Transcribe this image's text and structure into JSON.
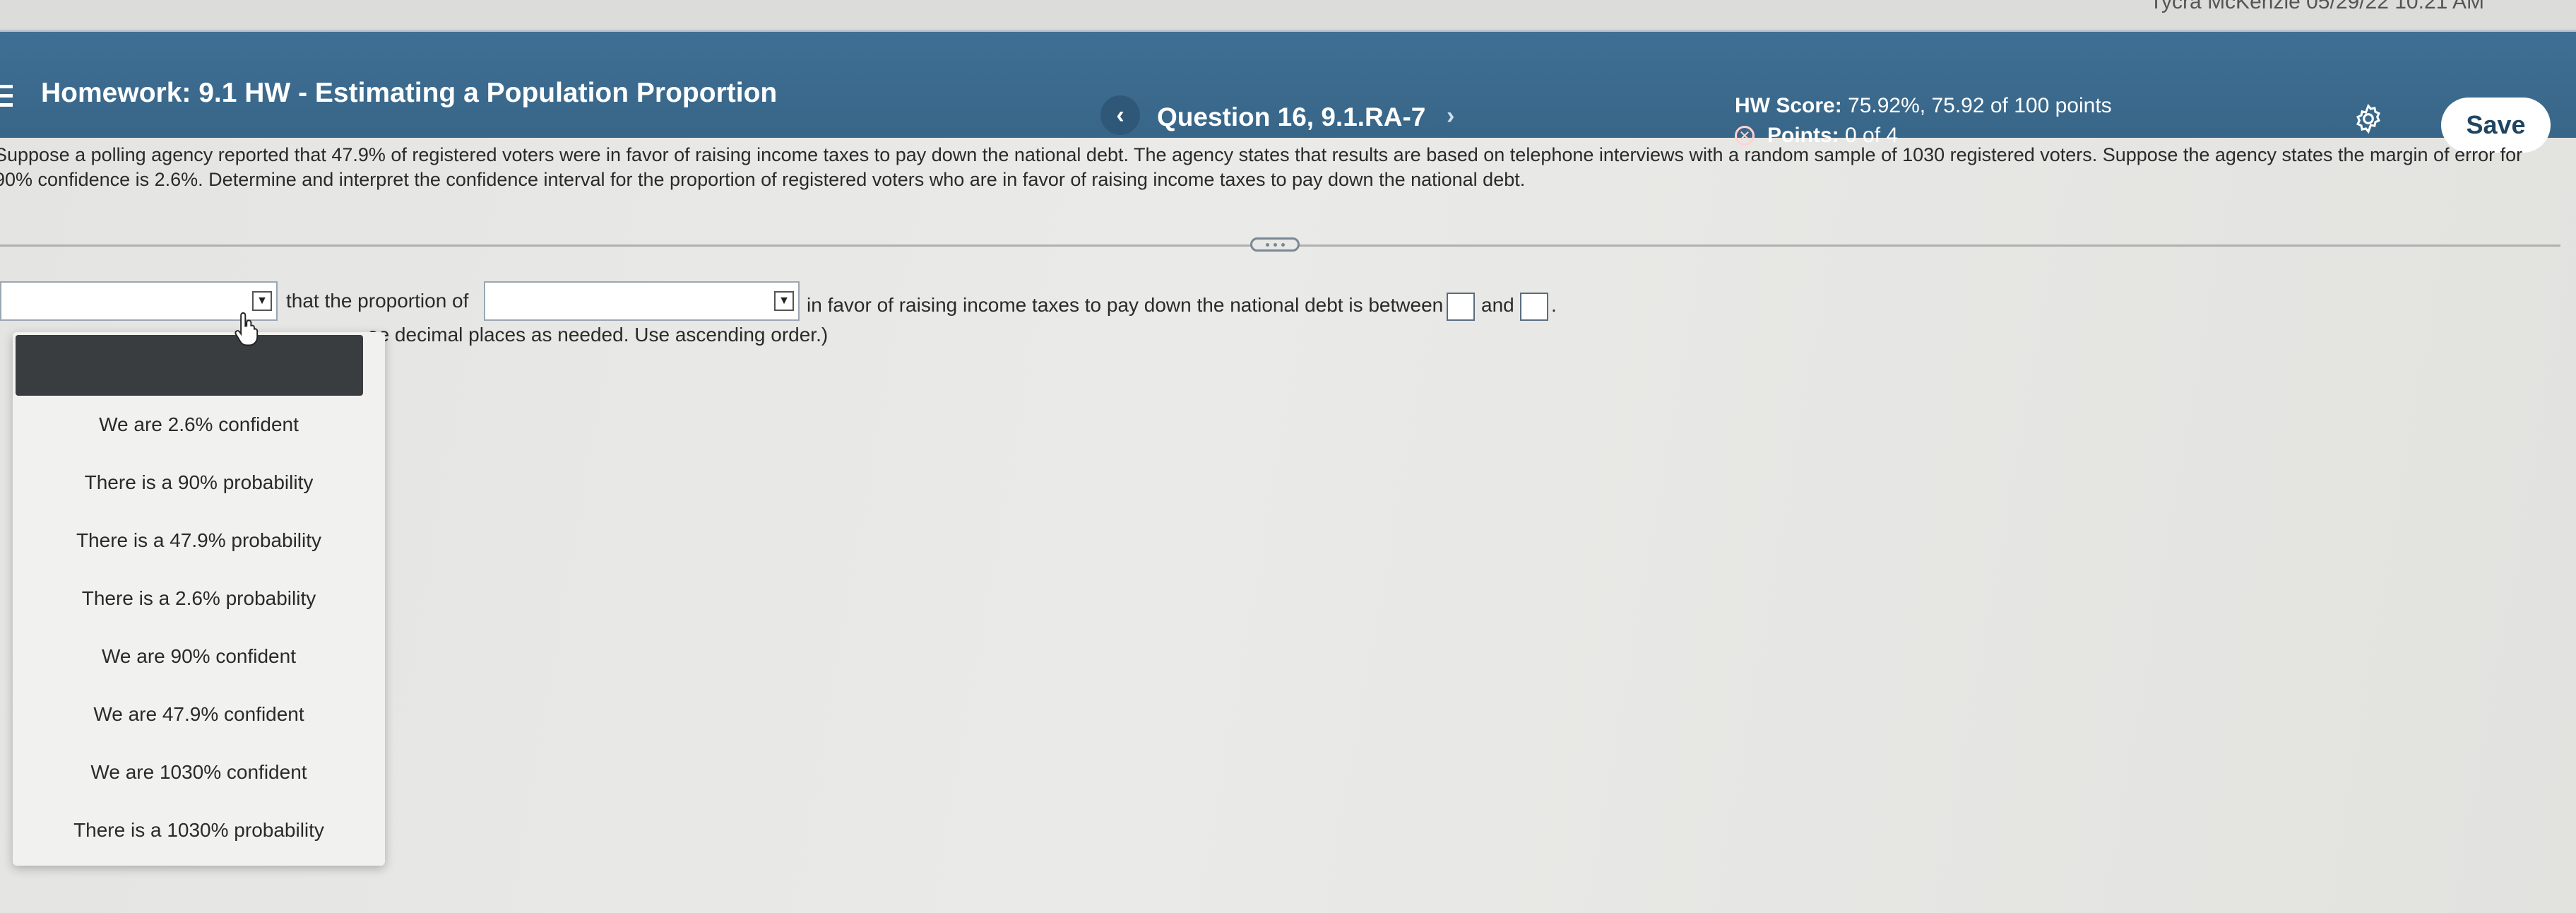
{
  "top_strip": {
    "meta": "Tycra McKenzie   05/29/22 10:21 AM"
  },
  "header": {
    "title": "Homework: 9.1 HW - Estimating a Population Proportion",
    "question": "Question 16, 9.1.RA-7",
    "prev_glyph": "‹",
    "next_glyph": "›",
    "score_label": "HW Score:",
    "score_value": "75.92%, 75.92 of 100 points",
    "points_label": "Points:",
    "points_value": "0 of 4",
    "save_label": "Save"
  },
  "question": {
    "text": "Suppose a polling agency reported that 47.9% of registered voters were in favor of raising income taxes to pay down the national debt. The agency states that results are based on telephone interviews with a random sample of 1030 registered voters. Suppose the agency states the margin of error for 90% confidence is 2.6%. Determine and interpret the confidence interval for the proportion of registered voters who are in favor of raising income taxes to pay down the national debt."
  },
  "answer": {
    "text_between": "that the proportion of",
    "text_after": "in favor of raising income taxes to pay down the national debt is between",
    "and_text": "and",
    "period": ".",
    "hint": "ee decimal places as needed. Use ascending order.)",
    "arrow_glyph": "▼"
  },
  "dropdown": {
    "options": [
      "We are 2.6% confident",
      "There is a 90% probability",
      "There is a 47.9% probability",
      "There is a 2.6% probability",
      "We are 90% confident",
      "We are 47.9% confident",
      "We are 1030% confident",
      "There is a 1030% probability"
    ]
  },
  "colors": {
    "header_bg": "#3f6f95",
    "save_text": "#1f4563",
    "dropdown_blank": "#3a3d40"
  }
}
